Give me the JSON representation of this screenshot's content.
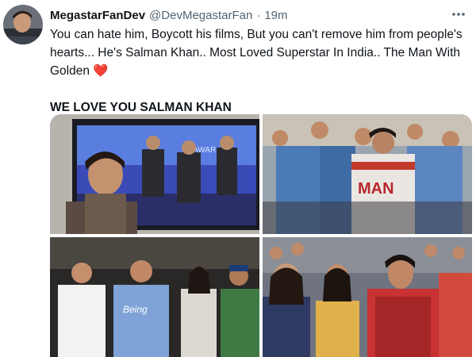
{
  "tweet": {
    "display_name": "MegastarFanDev",
    "handle": "@DevMegastarFan",
    "separator": "·",
    "time": "19m",
    "more_icon": "ellipsis-icon",
    "avatar_icon": "user-avatar",
    "text_lines": [
      "You can hate him, Boycott his films, But you can't remove him from people's",
      "hearts... He's Salman Khan.. Most Loved Superstar In India.. The Man With",
      "Golden"
    ],
    "heart_emoji": "❤️",
    "emphasis_line": "WE LOVE YOU SALMAN KHAN"
  },
  "media": {
    "image_count": 4,
    "images": [
      {
        "name": "photo-child-watching-tv",
        "shirt_text": ""
      },
      {
        "name": "photo-crowd-fans",
        "shirt_text": "MAN"
      },
      {
        "name": "photo-group-event",
        "shirt_text": "Being"
      },
      {
        "name": "photo-fans-selfie",
        "shirt_text": ""
      }
    ],
    "tv_label": "AWAR"
  },
  "colors": {
    "text_primary": "#0f1419",
    "text_secondary": "#536471",
    "heart": "#e0245e",
    "background": "#ffffff"
  }
}
